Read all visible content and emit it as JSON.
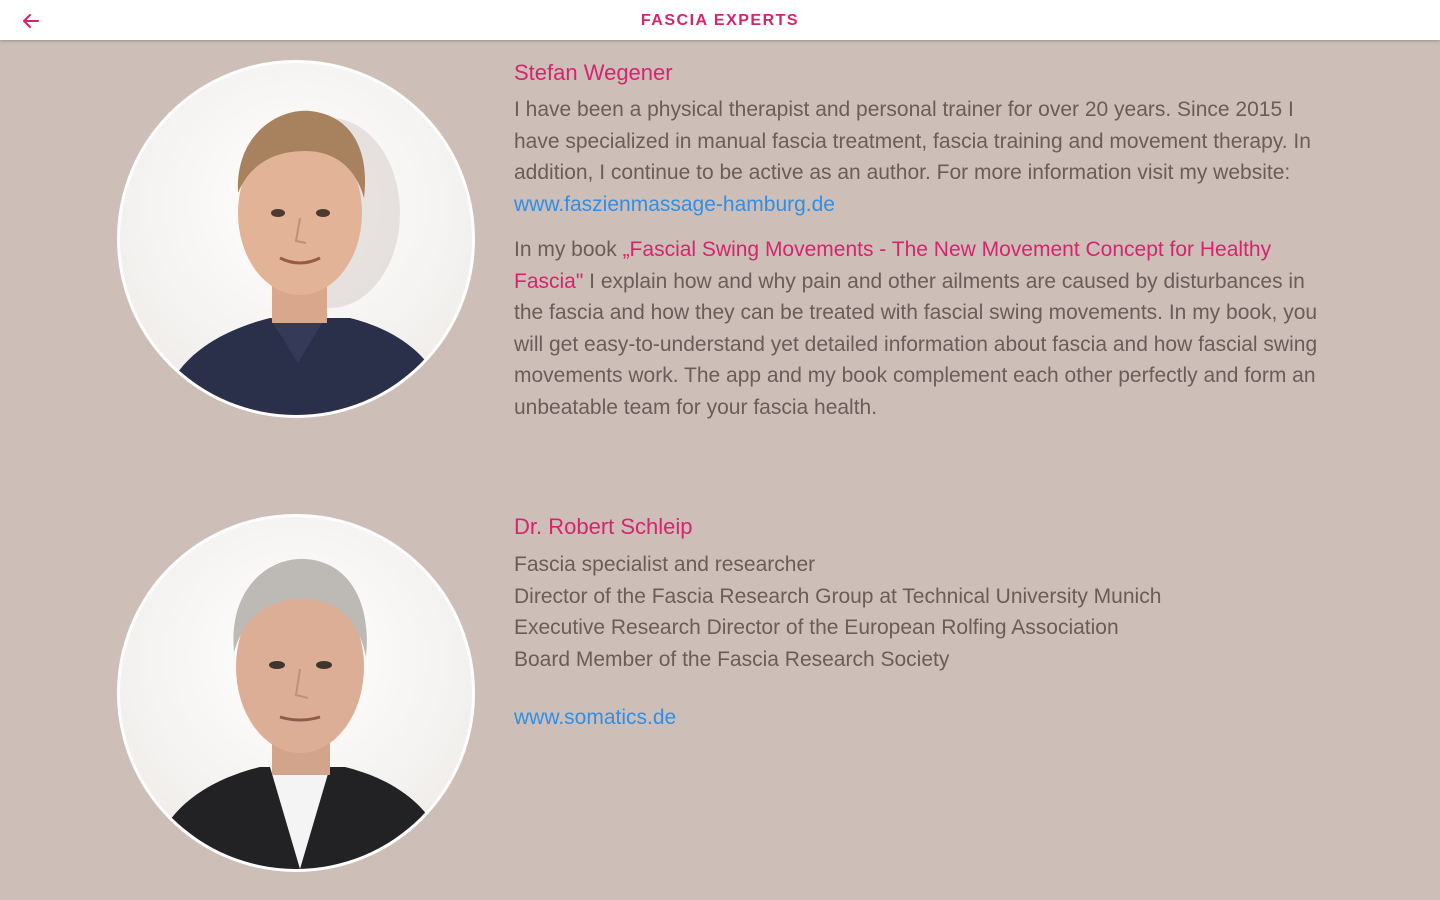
{
  "appbar": {
    "title": "FASCIA EXPERTS",
    "back_icon": "arrow-left-icon",
    "accent_color": "#d6246e"
  },
  "experts": [
    {
      "name": "Stefan Wegener",
      "bio_text": "I have been a physical therapist and personal trainer for over 20 years. Since 2015 I have specialized in manual fascia treatment, fascia training and movement therapy. In addition, I continue to be active as an author. For more information visit my website: ",
      "website": "www.faszienmassage-hamburg.de",
      "book_intro": "In my book ",
      "book_title": "„Fascial Swing Movements - The New Movement Concept for Healthy Fascia\"",
      "book_text": " I explain how and why pain and other ailments are caused by disturbances in the fascia and how they can be treated with fascial swing movements.  In my book, you will get easy-to-understand yet detailed information about fascia and how fascial swing movements work. The app and my book complement each other perfectly and form an unbeatable team for your fascia health."
    },
    {
      "name": "Dr. Robert Schleip",
      "roles": [
        "Fascia specialist and researcher",
        "Director of the Fascia Research Group at Technical University Munich",
        "Executive Research Director of the European Rolfing Association",
        "Board Member of the Fascia Research Society"
      ],
      "website": "www.somatics.de"
    }
  ],
  "colors": {
    "background": "#cdbfb8",
    "link": "#2f8fe8",
    "body_text": "#6a5d58"
  }
}
